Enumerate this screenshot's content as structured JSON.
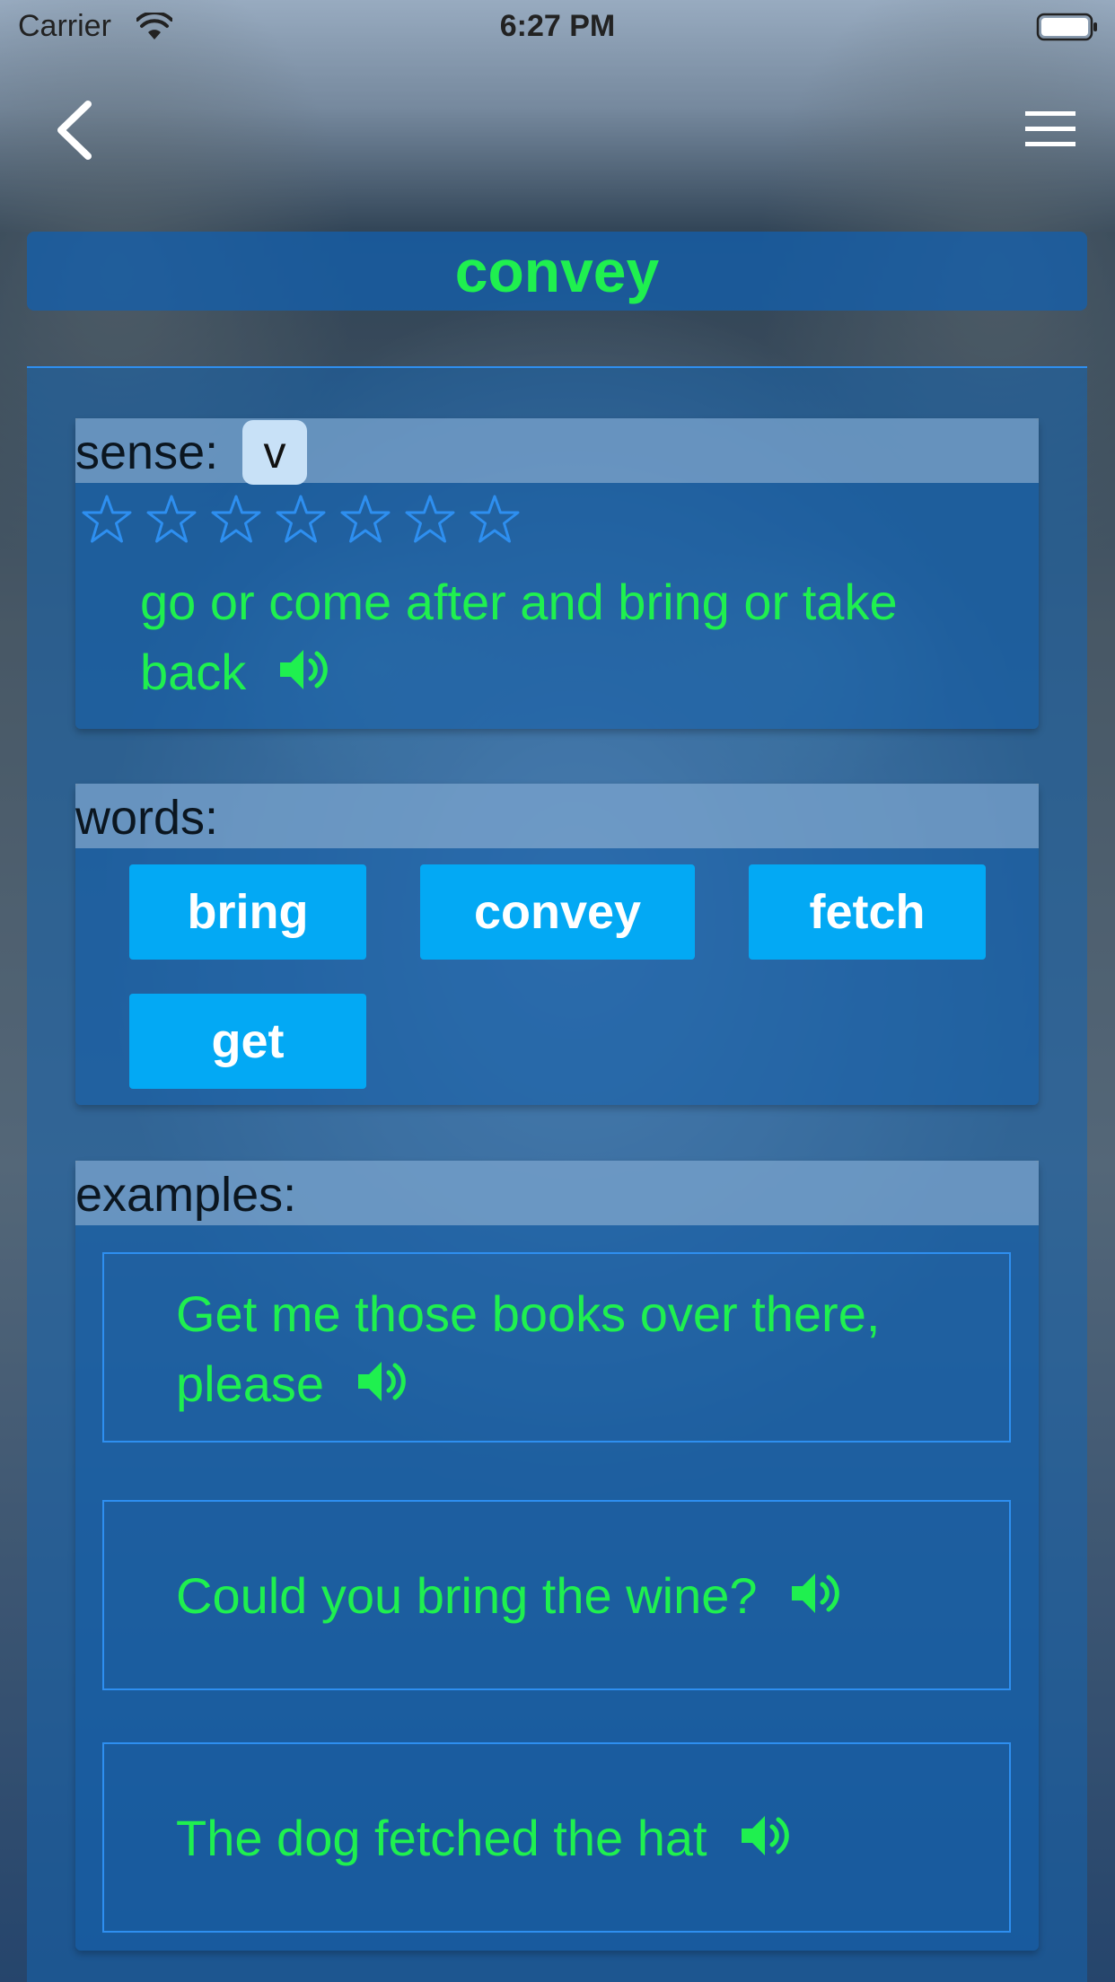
{
  "status_bar": {
    "carrier": "Carrier",
    "time": "6:27 PM",
    "icons": [
      "wifi-icon",
      "battery-icon"
    ]
  },
  "nav": {
    "icons": [
      "back-icon",
      "menu-icon"
    ]
  },
  "word": "convey",
  "sense": {
    "label": "sense:",
    "pos": "v",
    "rating": {
      "value": 0,
      "max": 7
    },
    "definition": "go or come after and bring or take back"
  },
  "words": {
    "label": "words:",
    "items": [
      "bring",
      "convey",
      "fetch",
      "get"
    ]
  },
  "examples": {
    "label": "examples:",
    "items": [
      "Get me those books over there, please",
      "Could you bring the wine?",
      "The dog fetched the hat"
    ]
  },
  "colors": {
    "word_green": "#1ff04f",
    "button_blue": "#03a9f4",
    "star_blue": "#2e8ff0"
  }
}
